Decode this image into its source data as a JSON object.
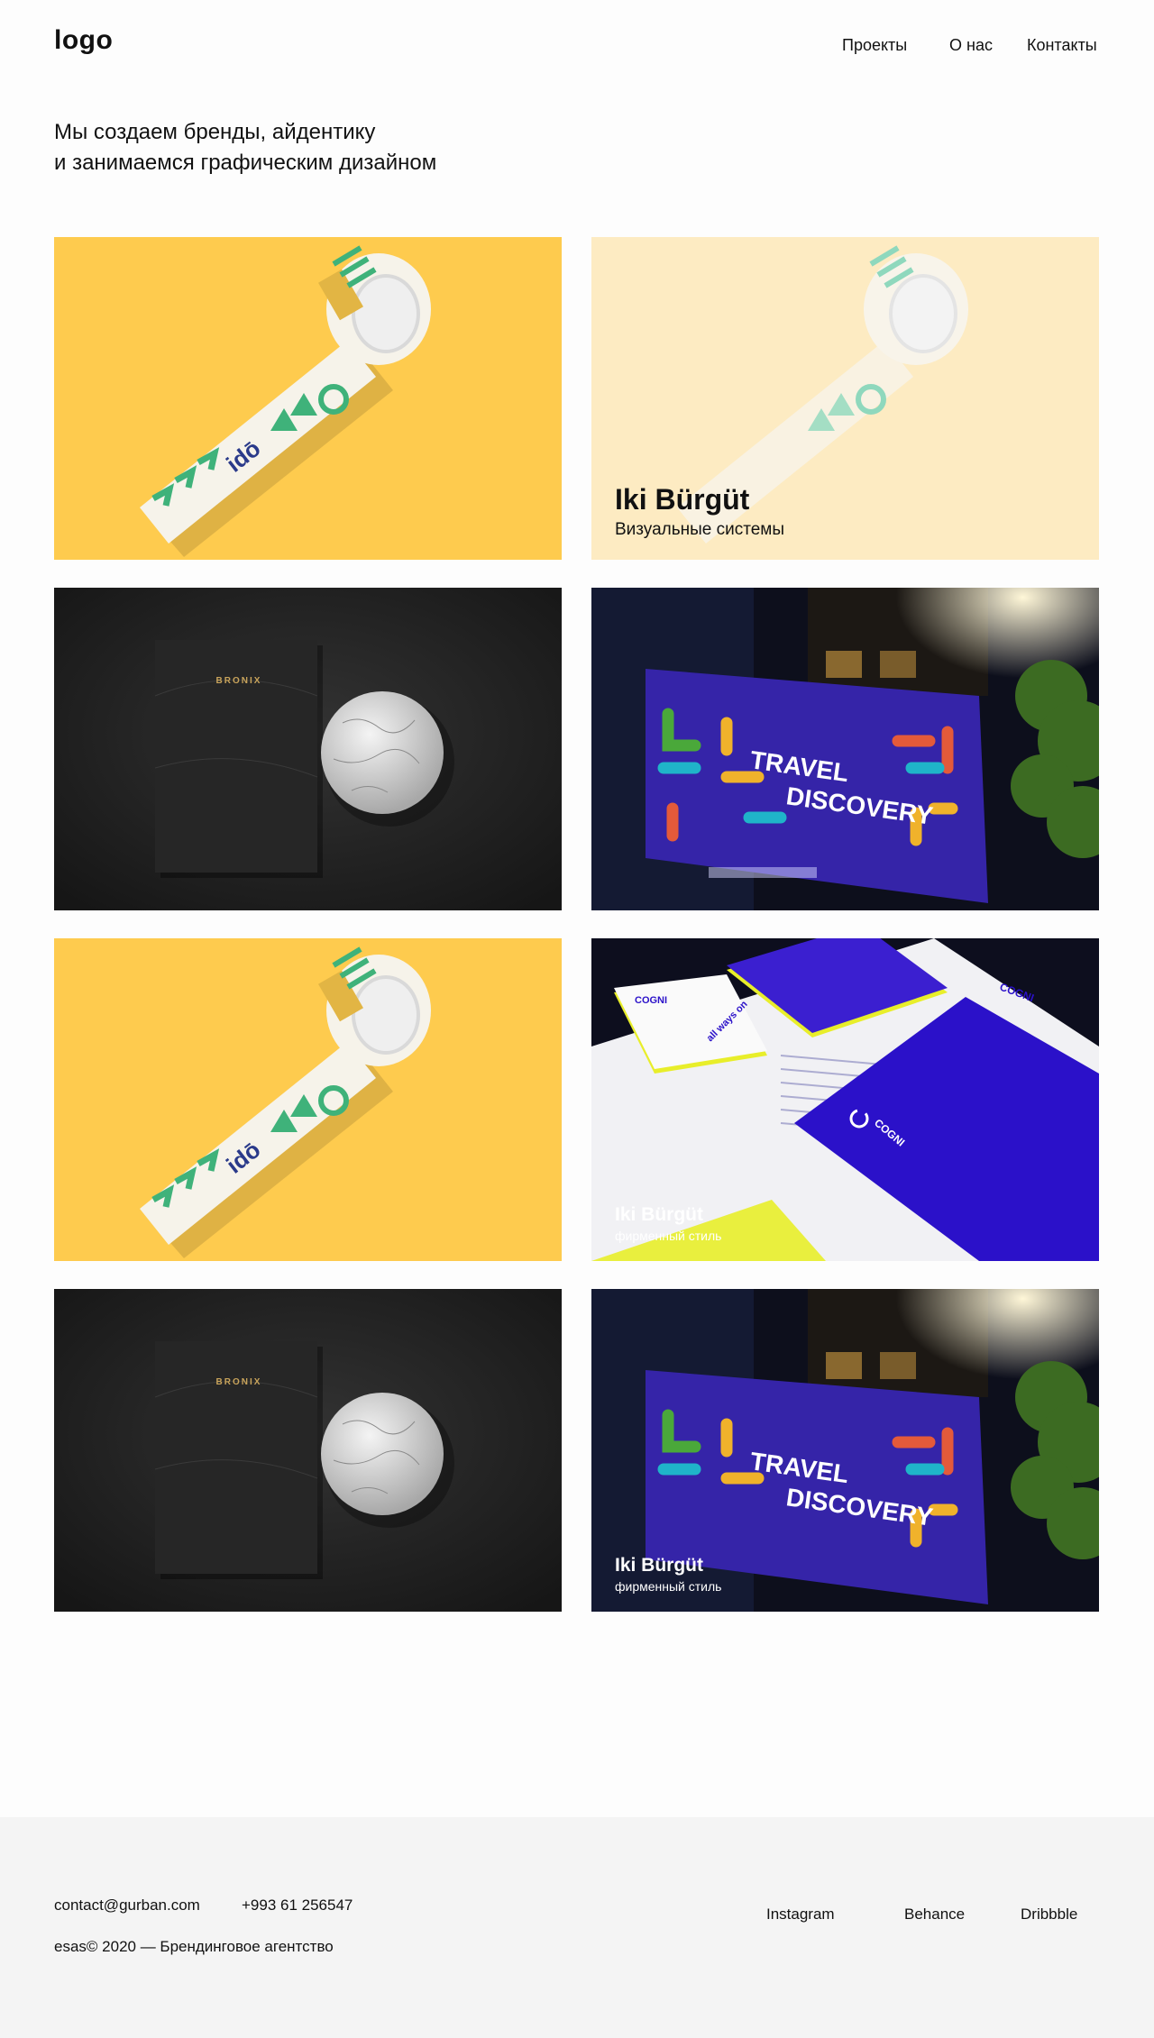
{
  "header": {
    "logo": "logo",
    "nav": [
      {
        "label": "Проекты"
      },
      {
        "label": "О нас"
      },
      {
        "label": "Контакты"
      }
    ]
  },
  "hero": {
    "line1": "Мы создаем бренды, айдентику",
    "line2": "и занимаемся графическим дизайном"
  },
  "projects": [
    {
      "image": "tape-roll-yellow",
      "title": "",
      "subtitle": ""
    },
    {
      "image": "tape-roll-light-yellow",
      "title": "Iki Bürgüt",
      "subtitle": "Визуальные системы"
    },
    {
      "image": "bronix-notebook-globe",
      "brand": "BRONIX",
      "title": "",
      "subtitle": ""
    },
    {
      "image": "travel-discovery-billboard",
      "billboard_line1": "TRAVEL",
      "billboard_line2": "DISCOVERY",
      "title": "",
      "subtitle": ""
    },
    {
      "image": "tape-roll-yellow",
      "title": "",
      "subtitle": ""
    },
    {
      "image": "cogni-stationery",
      "brand": "COGNI",
      "slogan": "all ways on",
      "title": "Iki Bürgüt",
      "subtitle": "фирменный стиль"
    },
    {
      "image": "bronix-notebook-globe",
      "brand": "BRONIX",
      "title": "",
      "subtitle": ""
    },
    {
      "image": "travel-discovery-billboard",
      "billboard_line1": "TRAVEL",
      "billboard_line2": "DISCOVERY",
      "title": "Iki Bürgüt",
      "subtitle": "фирменный стиль"
    }
  ],
  "footer": {
    "email": "contact@gurban.com",
    "phone": "+993 61 256547",
    "copyright": "esas© 2020 — Брендинговое агентство",
    "social": [
      {
        "label": "Instagram"
      },
      {
        "label": "Behance"
      },
      {
        "label": "Dribbble"
      }
    ]
  },
  "colors": {
    "yellow": "#fecb4e",
    "light_yellow": "#fdebc2",
    "dark": "#222222",
    "navy_blue": "#3524a8",
    "cogni_blue": "#2b11c9",
    "green": "#3fb27a"
  }
}
